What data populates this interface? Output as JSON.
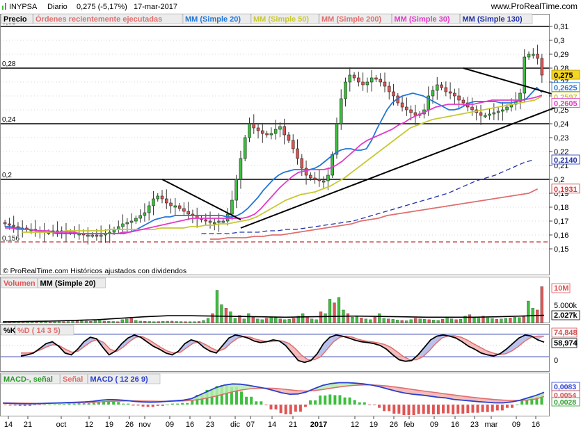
{
  "header": {
    "icon": "bar-chart-icon",
    "ticker": "INYPSA",
    "period": "Diario",
    "last": "0,275 (-5,17%)",
    "date": "17-mar-2017",
    "site": "www.ProRealTime.com"
  },
  "footer_note": "© ProRealTime.com  Históricos ajustados con dividendos",
  "price_legend": [
    "Precio",
    "Órdenes recientemente ejecutadas",
    "MM (Simple 20)",
    "MM (Simple 50)",
    "MM (Simple 200)",
    "MM (Simple 30)",
    "MM (Simple 130)"
  ],
  "volume_legend": [
    "Volumen",
    "MM (Simple 20)"
  ],
  "stoch_legend": [
    "%K",
    "%D ( 14 3 5)"
  ],
  "macd_legend": [
    "MACD-, señal",
    "Señal",
    "MACD ( 12 26 9)"
  ],
  "colors": {
    "up": "#3cbf3c",
    "down": "#e05454",
    "mm20": "#2276d8",
    "mm50": "#c8c832",
    "mm200": "#e06e6e",
    "mm30": "#e23bc8",
    "mm130": "#2232a8",
    "support": "#c03030"
  },
  "chart_data": [
    {
      "type": "candlestick",
      "name": "Precio",
      "ylim": [
        0.14,
        0.315
      ],
      "y_ticks": [
        "0,31",
        "0,3",
        "0,29",
        "0,28",
        "0,27",
        "0,26",
        "0,25",
        "0,24",
        "0,23",
        "0,22",
        "0,21",
        "0,2",
        "0,19",
        "0,18",
        "0,17",
        "0,16",
        "0,15"
      ],
      "x_ticks": [
        "14",
        "21",
        "oct",
        "12",
        "19",
        "26",
        "nov",
        "09",
        "16",
        "23",
        "dic",
        "07",
        "14",
        "21",
        "2017",
        "12",
        "19",
        "26",
        "feb",
        "09",
        "16",
        "23",
        "mar",
        "09",
        "16"
      ],
      "hlines": [
        {
          "value": 0.31,
          "label": "0,31"
        },
        {
          "value": 0.28,
          "label": "0,28"
        },
        {
          "value": 0.24,
          "label": "0,24"
        },
        {
          "value": 0.2,
          "label": "0,2"
        }
      ],
      "support_line": {
        "value": 0.155,
        "label": "0,156"
      },
      "close": [
        0.168,
        0.167,
        0.166,
        0.165,
        0.165,
        0.164,
        0.164,
        0.163,
        0.163,
        0.162,
        0.162,
        0.163,
        0.163,
        0.163,
        0.162,
        0.162,
        0.161,
        0.161,
        0.16,
        0.16,
        0.16,
        0.159,
        0.16,
        0.161,
        0.162,
        0.164,
        0.166,
        0.168,
        0.169,
        0.17,
        0.172,
        0.174,
        0.176,
        0.181,
        0.186,
        0.188,
        0.186,
        0.183,
        0.181,
        0.181,
        0.179,
        0.177,
        0.175,
        0.174,
        0.172,
        0.171,
        0.17,
        0.169,
        0.169,
        0.17,
        0.17,
        0.175,
        0.185,
        0.2,
        0.215,
        0.23,
        0.24,
        0.237,
        0.235,
        0.233,
        0.232,
        0.233,
        0.236,
        0.238,
        0.232,
        0.228,
        0.222,
        0.215,
        0.208,
        0.203,
        0.201,
        0.2,
        0.199,
        0.199,
        0.203,
        0.218,
        0.24,
        0.258,
        0.27,
        0.275,
        0.273,
        0.27,
        0.268,
        0.27,
        0.273,
        0.272,
        0.27,
        0.267,
        0.263,
        0.26,
        0.255,
        0.252,
        0.25,
        0.248,
        0.246,
        0.247,
        0.25,
        0.26,
        0.264,
        0.268,
        0.266,
        0.263,
        0.262,
        0.26,
        0.257,
        0.255,
        0.252,
        0.25,
        0.248,
        0.246,
        0.246,
        0.247,
        0.248,
        0.249,
        0.25,
        0.252,
        0.254,
        0.256,
        0.262,
        0.288,
        0.29,
        0.29,
        0.287,
        0.275
      ],
      "series": [
        {
          "name": "MM (Simple 20)",
          "color": "#2276d8",
          "values": [
            0.166,
            0.166,
            0.165,
            0.165,
            0.164,
            0.164,
            0.163,
            0.163,
            0.162,
            0.162,
            0.161,
            0.161,
            0.161,
            0.161,
            0.161,
            0.161,
            0.161,
            0.161,
            0.161,
            0.161,
            0.161,
            0.161,
            0.161,
            0.161,
            0.162,
            0.163,
            0.165,
            0.167,
            0.169,
            0.171,
            0.172,
            0.173,
            0.173,
            0.174,
            0.174,
            0.174,
            0.174,
            0.174,
            0.174,
            0.174,
            0.174,
            0.174,
            0.174,
            0.173,
            0.173,
            0.174,
            0.176,
            0.179,
            0.183,
            0.187,
            0.192,
            0.196,
            0.2,
            0.203,
            0.205,
            0.206,
            0.207,
            0.207,
            0.207,
            0.207,
            0.208,
            0.21,
            0.213,
            0.216,
            0.219,
            0.221,
            0.222,
            0.222,
            0.221,
            0.221,
            0.222,
            0.228,
            0.236,
            0.243,
            0.25,
            0.255,
            0.258,
            0.26,
            0.261,
            0.262,
            0.261,
            0.26,
            0.258,
            0.256,
            0.254,
            0.252,
            0.25,
            0.25,
            0.251,
            0.253,
            0.255,
            0.256,
            0.256,
            0.256,
            0.256,
            0.256,
            0.255,
            0.255,
            0.255,
            0.256,
            0.257,
            0.258,
            0.262,
            0.266,
            0.2625
          ]
        },
        {
          "name": "MM (Simple 50)",
          "color": "#c8c832",
          "values": [
            0.162,
            0.162,
            0.162,
            0.162,
            0.162,
            0.162,
            0.163,
            0.163,
            0.163,
            0.163,
            0.163,
            0.163,
            0.164,
            0.164,
            0.164,
            0.164,
            0.164,
            0.164,
            0.164,
            0.165,
            0.165,
            0.165,
            0.165,
            0.166,
            0.166,
            0.167,
            0.167,
            0.168,
            0.168,
            0.169,
            0.17,
            0.171,
            0.173,
            0.176,
            0.179,
            0.182,
            0.185,
            0.187,
            0.189,
            0.19,
            0.191,
            0.193,
            0.195,
            0.198,
            0.201,
            0.205,
            0.209,
            0.213,
            0.217,
            0.221,
            0.225,
            0.229,
            0.233,
            0.237,
            0.239,
            0.241,
            0.243,
            0.244,
            0.245,
            0.246,
            0.247,
            0.248,
            0.249,
            0.25,
            0.251,
            0.252,
            0.253,
            0.254,
            0.255,
            0.256,
            0.257,
            0.2597
          ]
        },
        {
          "name": "MM (Simple 30)",
          "color": "#e23bc8",
          "values": [
            0.165,
            0.165,
            0.164,
            0.164,
            0.164,
            0.163,
            0.163,
            0.163,
            0.162,
            0.162,
            0.162,
            0.162,
            0.161,
            0.161,
            0.161,
            0.161,
            0.161,
            0.161,
            0.161,
            0.162,
            0.162,
            0.163,
            0.164,
            0.165,
            0.166,
            0.167,
            0.168,
            0.169,
            0.17,
            0.171,
            0.172,
            0.172,
            0.172,
            0.172,
            0.172,
            0.172,
            0.172,
            0.172,
            0.172,
            0.173,
            0.175,
            0.179,
            0.184,
            0.189,
            0.194,
            0.198,
            0.202,
            0.205,
            0.206,
            0.207,
            0.207,
            0.207,
            0.208,
            0.21,
            0.213,
            0.217,
            0.221,
            0.225,
            0.228,
            0.23,
            0.232,
            0.234,
            0.236,
            0.239,
            0.241,
            0.244,
            0.246,
            0.248,
            0.25,
            0.252,
            0.253,
            0.254,
            0.254,
            0.254,
            0.254,
            0.254,
            0.255,
            0.256,
            0.257,
            0.257,
            0.257,
            0.257,
            0.257,
            0.257,
            0.258,
            0.259,
            0.2605
          ]
        },
        {
          "name": "MM (Simple 130)",
          "color": "#2232a8",
          "values": [
            0.161,
            0.161,
            0.161,
            0.161,
            0.162,
            0.162,
            0.162,
            0.163,
            0.163,
            0.164,
            0.164,
            0.165,
            0.166,
            0.167,
            0.168,
            0.169,
            0.17,
            0.172,
            0.174,
            0.176,
            0.178,
            0.18,
            0.182,
            0.184,
            0.186,
            0.188,
            0.19,
            0.193,
            0.196,
            0.199,
            0.201,
            0.203,
            0.206,
            0.209,
            0.212,
            0.214
          ]
        },
        {
          "name": "MM (Simple 200)",
          "color": "#e06e6e",
          "values": [
            0.157,
            0.157,
            0.158,
            0.158,
            0.158,
            0.159,
            0.159,
            0.16,
            0.16,
            0.161,
            0.162,
            0.163,
            0.164,
            0.165,
            0.166,
            0.167,
            0.168,
            0.17,
            0.171,
            0.172,
            0.174,
            0.175,
            0.176,
            0.177,
            0.178,
            0.179,
            0.18,
            0.181,
            0.182,
            0.183,
            0.184,
            0.185,
            0.186,
            0.187,
            0.188,
            0.189,
            0.19,
            0.1931
          ]
        }
      ],
      "value_labels": [
        "0,31",
        "0,3",
        "0,29",
        "0,28",
        "0,275",
        "0,2625",
        "0,2597",
        "0,2605",
        "0,2140",
        "0,1931"
      ]
    },
    {
      "type": "bar",
      "name": "Volumen",
      "y_ticks": [
        "10M",
        "5.000k",
        "2.027k"
      ],
      "values_k": [
        320,
        280,
        250,
        230,
        210,
        200,
        190,
        200,
        210,
        220,
        180,
        200,
        230,
        260,
        300,
        400,
        500,
        600,
        400,
        350,
        500,
        700,
        450,
        350,
        300,
        250,
        800,
        1000,
        1200,
        600,
        400,
        350,
        300,
        250,
        280,
        320,
        380,
        400,
        300,
        280,
        260,
        240,
        250,
        300,
        600,
        1200,
        2500,
        9000,
        5000,
        4000,
        3000,
        1200,
        2000,
        1000,
        2500,
        1500,
        1000,
        800,
        1200,
        1500,
        1400,
        1000,
        800,
        900,
        1200,
        1800,
        2500,
        1500,
        1000,
        800,
        3000,
        2500,
        6500,
        5500,
        7000,
        3500,
        2500,
        1500,
        1800,
        1300,
        1000,
        800,
        1500,
        2500,
        1200,
        1000,
        900,
        700,
        600,
        500,
        800,
        1200,
        1000,
        900,
        800,
        700,
        600,
        900,
        1200,
        1000,
        800,
        900,
        1800,
        2200,
        1500,
        1200,
        1800,
        1300,
        1100,
        900,
        1000,
        1200,
        1300,
        1500,
        1400,
        1700,
        6000,
        4000,
        3500,
        10000
      ],
      "ma20_k": [
        200,
        300,
        400,
        600,
        800,
        1200,
        1600,
        1900,
        1900,
        1800,
        1700,
        1600,
        1500,
        1600,
        1700,
        1800,
        1700,
        1600,
        1500,
        1500,
        1500,
        1600,
        1800,
        2027
      ]
    },
    {
      "type": "line",
      "name": "%K / %D ( 14 3 5)",
      "y_ticks": [
        "74,848",
        "58,974",
        "0"
      ],
      "k": [
        22,
        25,
        30,
        42,
        55,
        60,
        48,
        30,
        25,
        40,
        60,
        72,
        68,
        45,
        25,
        35,
        55,
        70,
        78,
        72,
        60,
        48,
        40,
        30,
        25,
        35,
        55,
        65,
        60,
        45,
        35,
        30,
        50,
        70,
        78,
        75,
        70,
        62,
        58,
        60,
        65,
        62,
        50,
        30,
        10,
        5,
        10,
        28,
        55,
        72,
        78,
        75,
        70,
        64,
        60,
        58,
        55,
        50,
        40,
        25,
        12,
        8,
        10,
        25,
        45,
        65,
        75,
        78,
        75,
        70,
        60,
        48,
        40,
        30,
        25,
        22,
        28,
        40,
        55,
        70,
        78,
        75,
        65,
        58.974
      ],
      "d": [
        30,
        30,
        32,
        38,
        46,
        52,
        50,
        40,
        32,
        35,
        48,
        60,
        66,
        58,
        40,
        34,
        45,
        60,
        72,
        74,
        66,
        55,
        44,
        35,
        30,
        32,
        44,
        56,
        60,
        52,
        42,
        35,
        42,
        58,
        70,
        74,
        72,
        66,
        62,
        60,
        62,
        62,
        56,
        42,
        24,
        12,
        12,
        20,
        40,
        60,
        72,
        75,
        72,
        66,
        62,
        60,
        57,
        53,
        45,
        33,
        20,
        12,
        12,
        20,
        36,
        55,
        70,
        76,
        76,
        72,
        64,
        54,
        45,
        36,
        30,
        26,
        28,
        36,
        48,
        62,
        72,
        75,
        74.848
      ]
    },
    {
      "type": "line",
      "name": "MACD ( 12 26 9)",
      "y_ticks": [
        "0,0083",
        "0,0054",
        "0,0028"
      ],
      "macd": [
        0.001,
        0.0008,
        0.0006,
        0.0005,
        0.0006,
        0.0008,
        0.001,
        0.0012,
        0.0014,
        0.0016,
        0.0018,
        0.0022,
        0.003,
        0.0034,
        0.0032,
        0.0028,
        0.0022,
        0.0018,
        0.0016,
        0.0018,
        0.0022,
        0.0026,
        0.003,
        0.004,
        0.0065,
        0.009,
        0.0115,
        0.0132,
        0.014,
        0.0138,
        0.013,
        0.012,
        0.011,
        0.0095,
        0.008,
        0.007,
        0.0072,
        0.0085,
        0.0108,
        0.013,
        0.0142,
        0.0148,
        0.0148,
        0.0145,
        0.014,
        0.0132,
        0.012,
        0.0105,
        0.009,
        0.0078,
        0.007,
        0.0065,
        0.0058,
        0.005,
        0.0045,
        0.0035,
        0.003,
        0.0025,
        0.002,
        0.0016,
        0.0012,
        0.0012,
        0.0018,
        0.0028,
        0.0045,
        0.0062,
        0.0083
      ],
      "signal": [
        0.0012,
        0.0011,
        0.001,
        0.0009,
        0.0008,
        0.0008,
        0.0009,
        0.001,
        0.0011,
        0.0012,
        0.0014,
        0.0016,
        0.0019,
        0.0022,
        0.0024,
        0.0025,
        0.0025,
        0.0024,
        0.0023,
        0.0022,
        0.0022,
        0.0023,
        0.0025,
        0.0028,
        0.0035,
        0.0045,
        0.0058,
        0.0072,
        0.0086,
        0.0098,
        0.0106,
        0.011,
        0.0111,
        0.011,
        0.0106,
        0.01,
        0.0094,
        0.0092,
        0.0095,
        0.0102,
        0.0111,
        0.0119,
        0.0126,
        0.0131,
        0.0133,
        0.0133,
        0.013,
        0.0125,
        0.0118,
        0.011,
        0.0102,
        0.0094,
        0.0087,
        0.008,
        0.0072,
        0.0065,
        0.0058,
        0.0051,
        0.0045,
        0.0039,
        0.0034,
        0.003,
        0.0028,
        0.0028,
        0.0031,
        0.0038,
        0.0054
      ]
    }
  ]
}
